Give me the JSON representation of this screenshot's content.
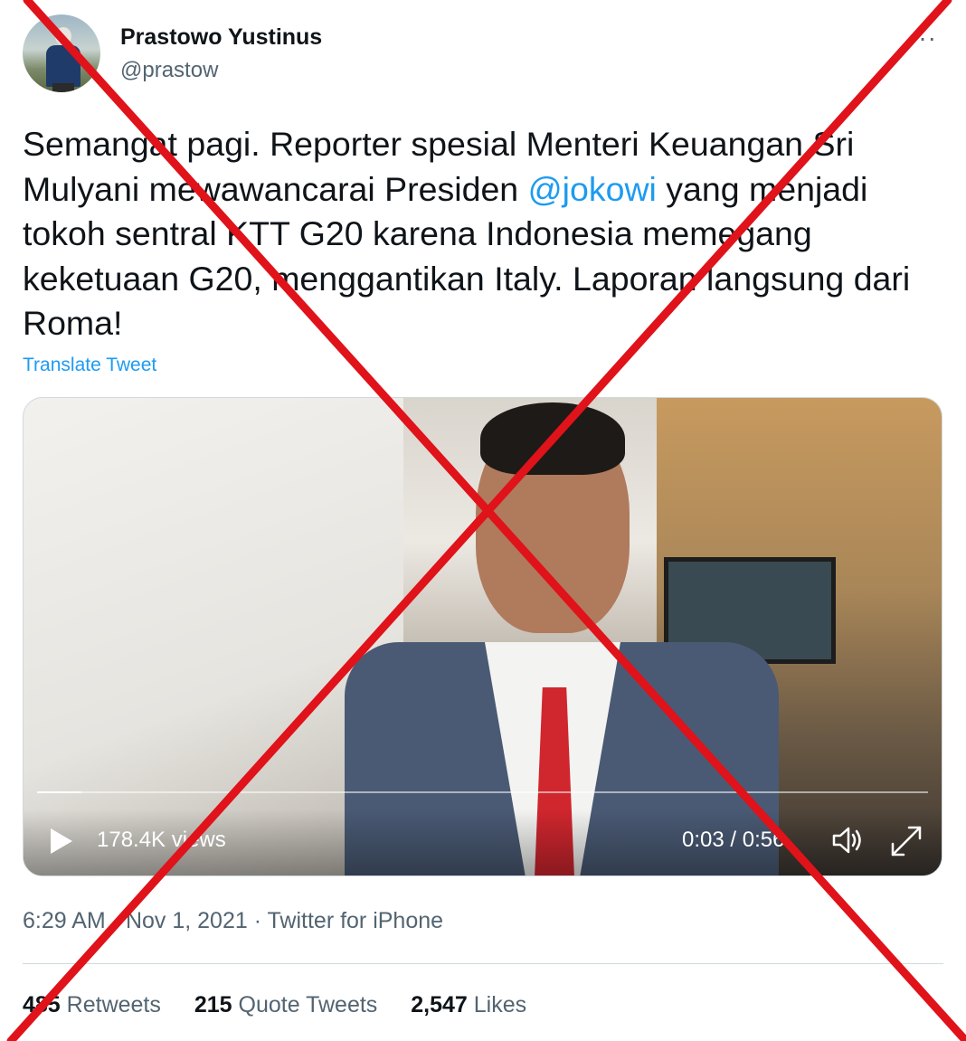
{
  "author": {
    "name": "Prastowo Yustinus",
    "handle": "@prastow"
  },
  "tweet": {
    "text_before": "Semangat pagi. Reporter spesial Menteri Keuangan Sri Mulyani mewawancarai Presiden ",
    "mention": "@jokowi",
    "text_after": " yang menjadi tokoh sentral KTT G20 karena Indonesia memegang keketuaan G20, menggantikan Italy. Laporan langsung dari Roma!",
    "translate_label": "Translate Tweet"
  },
  "video": {
    "views": "178.4K views",
    "time": "0:03 / 0:56",
    "progress_fraction": 0.05
  },
  "meta_line": "6:29 AM · Nov 1, 2021 · Twitter for iPhone",
  "stats": [
    {
      "count": "485",
      "label": " Retweets"
    },
    {
      "count": "215",
      "label": " Quote Tweets"
    },
    {
      "count": "2,547",
      "label": " Likes"
    }
  ],
  "more_glyph": "···",
  "overlay_color": "#e0121a",
  "icons": [
    "more-icon",
    "play-icon",
    "volume-icon",
    "fullscreen-icon"
  ]
}
